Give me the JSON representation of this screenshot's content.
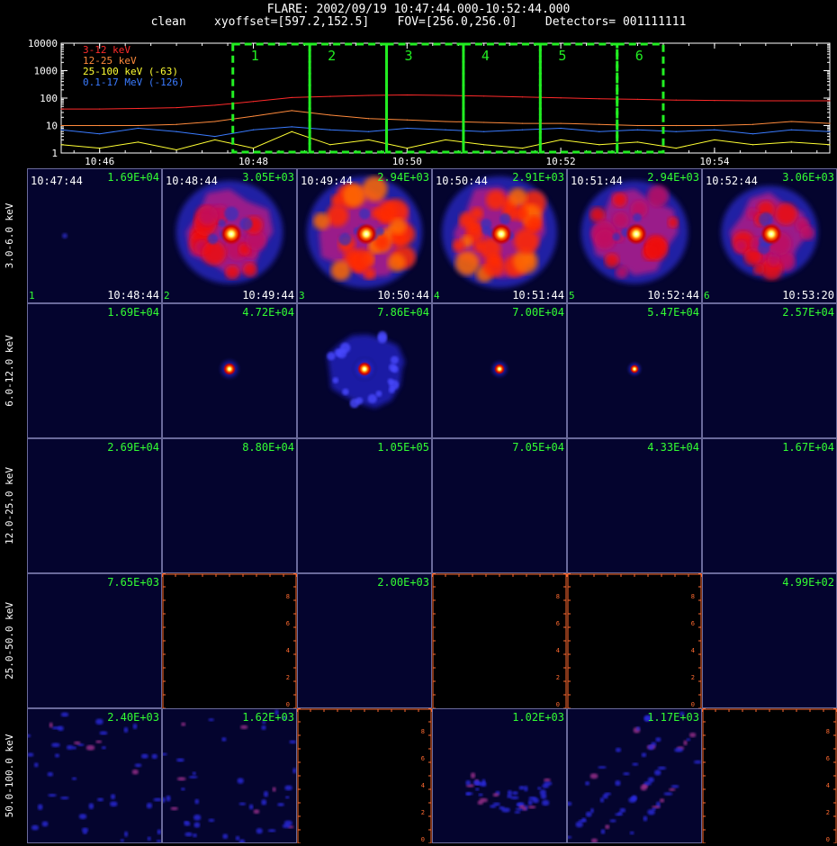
{
  "header": {
    "title": "FLARE: 2002/09/19 10:47:44.000-10:52:44.000",
    "subtitle": "clean    xyoffset=[597.2,152.5]    FOV=[256.0,256.0]    Detectors= 001111111"
  },
  "colors": {
    "background": "#000000",
    "panel_bg": "#04042e",
    "label_green": "#33ff33",
    "band_3_12": "#ff2a2a",
    "band_12_25": "#ff8a3c",
    "band_25_100": "#ffff33",
    "band_01_17": "#3a7bff",
    "box_green": "#22ee22",
    "empty_axis": "#ff6a30"
  },
  "chart_data": [
    {
      "type": "line",
      "title": "",
      "xlabel": "",
      "ylabel": "",
      "log_y": true,
      "ylim": [
        1,
        10000
      ],
      "xlim": [
        "10:45:30",
        "10:55:30"
      ],
      "x_ticks": [
        "10:46",
        "10:48",
        "10:50",
        "10:52",
        "10:54"
      ],
      "y_ticks": [
        "1",
        "10",
        "100",
        "1000",
        "10000"
      ],
      "legend_position": "top-left",
      "series": [
        {
          "name": "3-12 keV",
          "color": "#ff2a2a",
          "x": [
            "10:45:30",
            "10:46:00",
            "10:46:30",
            "10:47:00",
            "10:47:30",
            "10:48:00",
            "10:48:30",
            "10:49:00",
            "10:49:30",
            "10:50:00",
            "10:50:30",
            "10:51:00",
            "10:51:30",
            "10:52:00",
            "10:52:30",
            "10:53:00",
            "10:53:30",
            "10:54:00",
            "10:54:30",
            "10:55:00",
            "10:55:30"
          ],
          "values": [
            40,
            40,
            42,
            45,
            55,
            75,
            105,
            115,
            125,
            130,
            125,
            118,
            110,
            102,
            95,
            90,
            85,
            82,
            80,
            80,
            80
          ]
        },
        {
          "name": "12-25 keV",
          "color": "#ff8a3c",
          "x": [
            "10:45:30",
            "10:46:00",
            "10:46:30",
            "10:47:00",
            "10:47:30",
            "10:48:00",
            "10:48:30",
            "10:49:00",
            "10:49:30",
            "10:50:00",
            "10:50:30",
            "10:51:00",
            "10:51:30",
            "10:52:00",
            "10:52:30",
            "10:53:00",
            "10:53:30",
            "10:54:00",
            "10:54:30",
            "10:55:00",
            "10:55:30"
          ],
          "values": [
            10,
            10,
            10,
            11,
            14,
            22,
            35,
            24,
            18,
            16,
            14,
            13,
            12,
            12,
            11,
            10,
            10,
            10,
            11,
            14,
            12
          ]
        },
        {
          "name": "25-100 keV (-63)",
          "color": "#ffff33",
          "x": [
            "10:45:30",
            "10:46:00",
            "10:46:30",
            "10:47:00",
            "10:47:30",
            "10:48:00",
            "10:48:30",
            "10:49:00",
            "10:49:30",
            "10:50:00",
            "10:50:30",
            "10:51:00",
            "10:51:30",
            "10:52:00",
            "10:52:30",
            "10:53:00",
            "10:53:30",
            "10:54:00",
            "10:54:30",
            "10:55:00",
            "10:55:30"
          ],
          "values": [
            2,
            1.5,
            2.5,
            1.3,
            3,
            1.5,
            6,
            2,
            3,
            1.5,
            3,
            2,
            1.5,
            3,
            2,
            2.5,
            1.5,
            3,
            2,
            2.5,
            2
          ]
        },
        {
          "name": "0.1-17 MeV (-126)",
          "color": "#3a7bff",
          "x": [
            "10:45:30",
            "10:46:00",
            "10:46:30",
            "10:47:00",
            "10:47:30",
            "10:48:00",
            "10:48:30",
            "10:49:00",
            "10:49:30",
            "10:50:00",
            "10:50:30",
            "10:51:00",
            "10:51:30",
            "10:52:00",
            "10:52:30",
            "10:53:00",
            "10:53:30",
            "10:54:00",
            "10:54:30",
            "10:55:00",
            "10:55:30"
          ],
          "values": [
            7,
            5,
            8,
            6,
            4,
            7,
            9,
            7,
            6,
            8,
            7,
            6,
            7,
            8,
            6,
            7,
            6,
            7,
            5,
            7,
            6
          ]
        }
      ],
      "intervals": [
        {
          "label": "1",
          "start": "10:47:44",
          "end": "10:48:44"
        },
        {
          "label": "2",
          "start": "10:48:44",
          "end": "10:49:44"
        },
        {
          "label": "3",
          "start": "10:49:44",
          "end": "10:50:44"
        },
        {
          "label": "4",
          "start": "10:50:44",
          "end": "10:51:44"
        },
        {
          "label": "5",
          "start": "10:51:44",
          "end": "10:52:44"
        },
        {
          "label": "6",
          "start": "10:52:44",
          "end": "10:53:20"
        }
      ]
    },
    {
      "type": "heatmap",
      "title": "",
      "energy_bands": [
        "3.0-6.0 keV",
        "6.0-12.0 keV",
        "12.0-25.0 keV",
        "25.0-50.0 keV",
        "50.0-100.0 keV"
      ],
      "intervals": [
        {
          "index": "1",
          "start": "10:47:44",
          "end": "10:48:44"
        },
        {
          "index": "2",
          "start": "10:48:44",
          "end": "10:49:44"
        },
        {
          "index": "3",
          "start": "10:49:44",
          "end": "10:50:44"
        },
        {
          "index": "4",
          "start": "10:50:44",
          "end": "10:51:44"
        },
        {
          "index": "5",
          "start": "10:51:44",
          "end": "10:52:44"
        },
        {
          "index": "6",
          "start": "10:52:44",
          "end": "10:53:20"
        }
      ],
      "peak_flux": [
        [
          "1.69E+04",
          "3.05E+03",
          "2.94E+03",
          "2.91E+03",
          "2.94E+03",
          "3.06E+03"
        ],
        [
          "1.69E+04",
          "4.72E+04",
          "7.86E+04",
          "7.00E+04",
          "5.47E+04",
          "2.57E+04"
        ],
        [
          "2.69E+04",
          "8.80E+04",
          "1.05E+05",
          "7.05E+04",
          "4.33E+04",
          "1.67E+04"
        ],
        [
          "7.65E+03",
          "",
          "2.00E+03",
          "",
          "",
          "4.99E+02"
        ],
        [
          "2.40E+03",
          "1.62E+03",
          "",
          "1.02E+03",
          "1.17E+03",
          ""
        ]
      ],
      "empty_axis_ticks": [
        "0",
        "2",
        "4",
        "6",
        "8"
      ],
      "image_state": [
        [
          "faint",
          "ring-bright",
          "ring-saturated",
          "ring-saturated",
          "ring-bright",
          "ring-medium"
        ],
        [
          "none",
          "core-bright",
          "core-halo",
          "core-medium",
          "core-faint",
          "none"
        ],
        [
          "none",
          "none",
          "none",
          "none",
          "none",
          "none"
        ],
        [
          "none",
          "empty",
          "none",
          "empty",
          "empty",
          "none"
        ],
        [
          "noise",
          "noise",
          "empty",
          "noise-arc",
          "noise-stripes",
          "empty"
        ]
      ]
    }
  ]
}
